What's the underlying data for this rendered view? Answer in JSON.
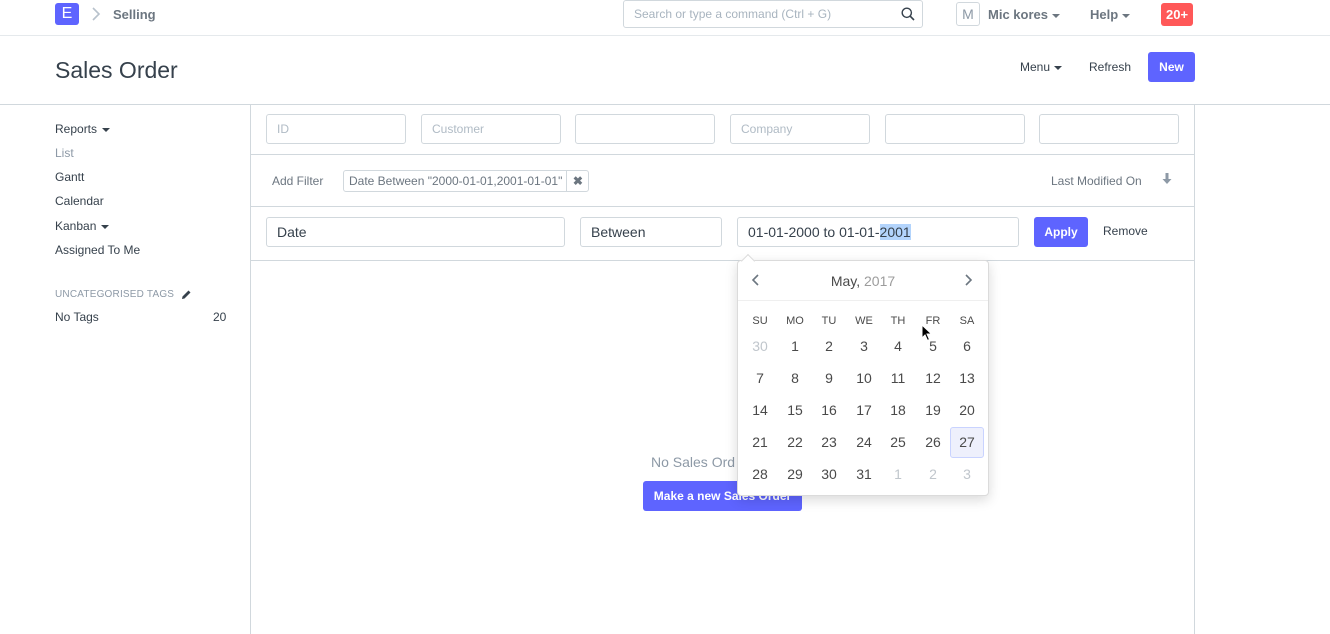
{
  "navbar": {
    "logo_letter": "E",
    "breadcrumb": "Selling",
    "search_placeholder": "Search or type a command (Ctrl + G)",
    "avatar_letter": "M",
    "user_name": "Mic kores",
    "help_label": "Help",
    "notification_badge": "20+"
  },
  "page": {
    "title": "Sales Order",
    "menu_label": "Menu",
    "refresh_label": "Refresh",
    "new_label": "New"
  },
  "sidebar": {
    "items": [
      "Reports",
      "List",
      "Gantt",
      "Calendar",
      "Kanban",
      "Assigned To Me"
    ],
    "tags_heading": "UNCATEGORISED TAGS",
    "no_tags_label": "No Tags",
    "no_tags_count": "20"
  },
  "filters": {
    "standard_placeholders": [
      "ID",
      "Customer",
      "",
      "Company",
      "",
      ""
    ],
    "add_filter_label": "Add Filter",
    "active_filter_tag": "Date Between \"2000-01-01,2001-01-01\"",
    "sort_label": "Last Modified On",
    "edit_field": "Date",
    "edit_condition": "Between",
    "edit_value_prefix": "01-01-2000 to 01-01-",
    "edit_value_selected": "2001",
    "apply_label": "Apply",
    "remove_label": "Remove"
  },
  "empty_state": {
    "message": "No Sales Ord",
    "button_label": "Make a new Sales Order"
  },
  "datepicker": {
    "month": "May,",
    "year": "2017",
    "weekdays": [
      "SU",
      "MO",
      "TU",
      "WE",
      "TH",
      "FR",
      "SA"
    ],
    "weeks": [
      [
        "30",
        "1",
        "2",
        "3",
        "4",
        "5",
        "6"
      ],
      [
        "7",
        "8",
        "9",
        "10",
        "11",
        "12",
        "13"
      ],
      [
        "14",
        "15",
        "16",
        "17",
        "18",
        "19",
        "20"
      ],
      [
        "21",
        "22",
        "23",
        "24",
        "25",
        "26",
        "27"
      ],
      [
        "28",
        "29",
        "30",
        "31",
        "1",
        "2",
        "3"
      ]
    ],
    "current_day": "27"
  },
  "colors": {
    "primary": "#5e64ff",
    "badge": "#ff5858",
    "text": "#36414c",
    "muted": "#8d99a6"
  }
}
